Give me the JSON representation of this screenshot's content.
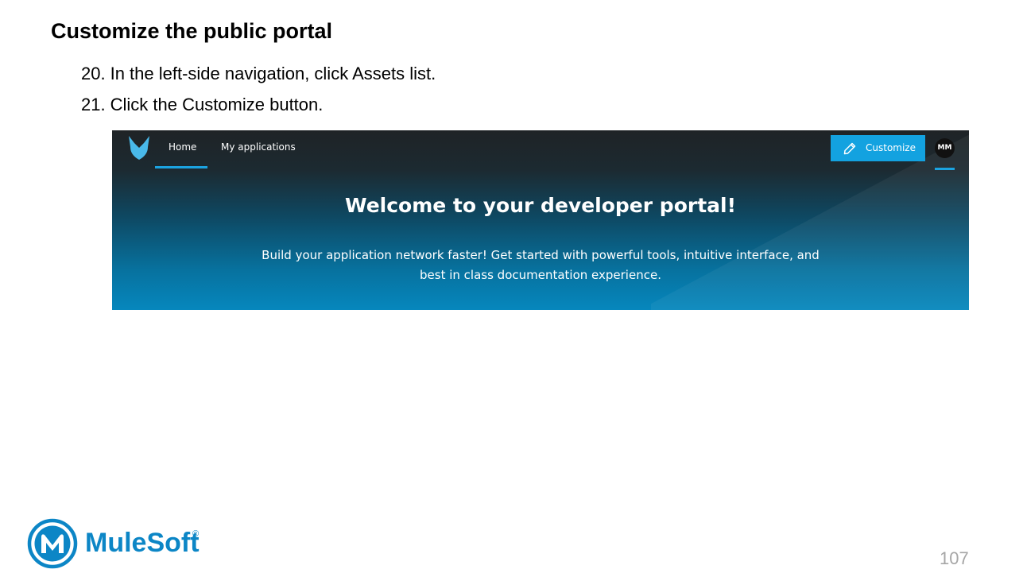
{
  "slide": {
    "title": "Customize the public portal",
    "steps": [
      {
        "number": "20.",
        "text": "In the left-side navigation, click Assets list."
      },
      {
        "number": "21.",
        "text": "Click the Customize button."
      }
    ],
    "page_number": "107"
  },
  "portal": {
    "nav": {
      "items": [
        {
          "label": "Home",
          "active": true
        },
        {
          "label": "My applications",
          "active": false
        }
      ],
      "customize_label": "Customize",
      "avatar_initials": "MM"
    },
    "hero": {
      "title": "Welcome to your developer portal!",
      "subtitle_line1": "Build your application network faster! Get started with powerful tools, intuitive interface, and",
      "subtitle_line2": "best in class documentation experience."
    },
    "icons": {
      "logo": "anypoint-portal-logo-icon",
      "customize": "pencil-icon"
    }
  },
  "brand": {
    "name": "MuleSoft",
    "mark": "®",
    "color": "#0c86c6"
  },
  "colors": {
    "accent": "#13a2e0",
    "nav_background": "#1f2326",
    "page_number": "#a6a6a6"
  }
}
